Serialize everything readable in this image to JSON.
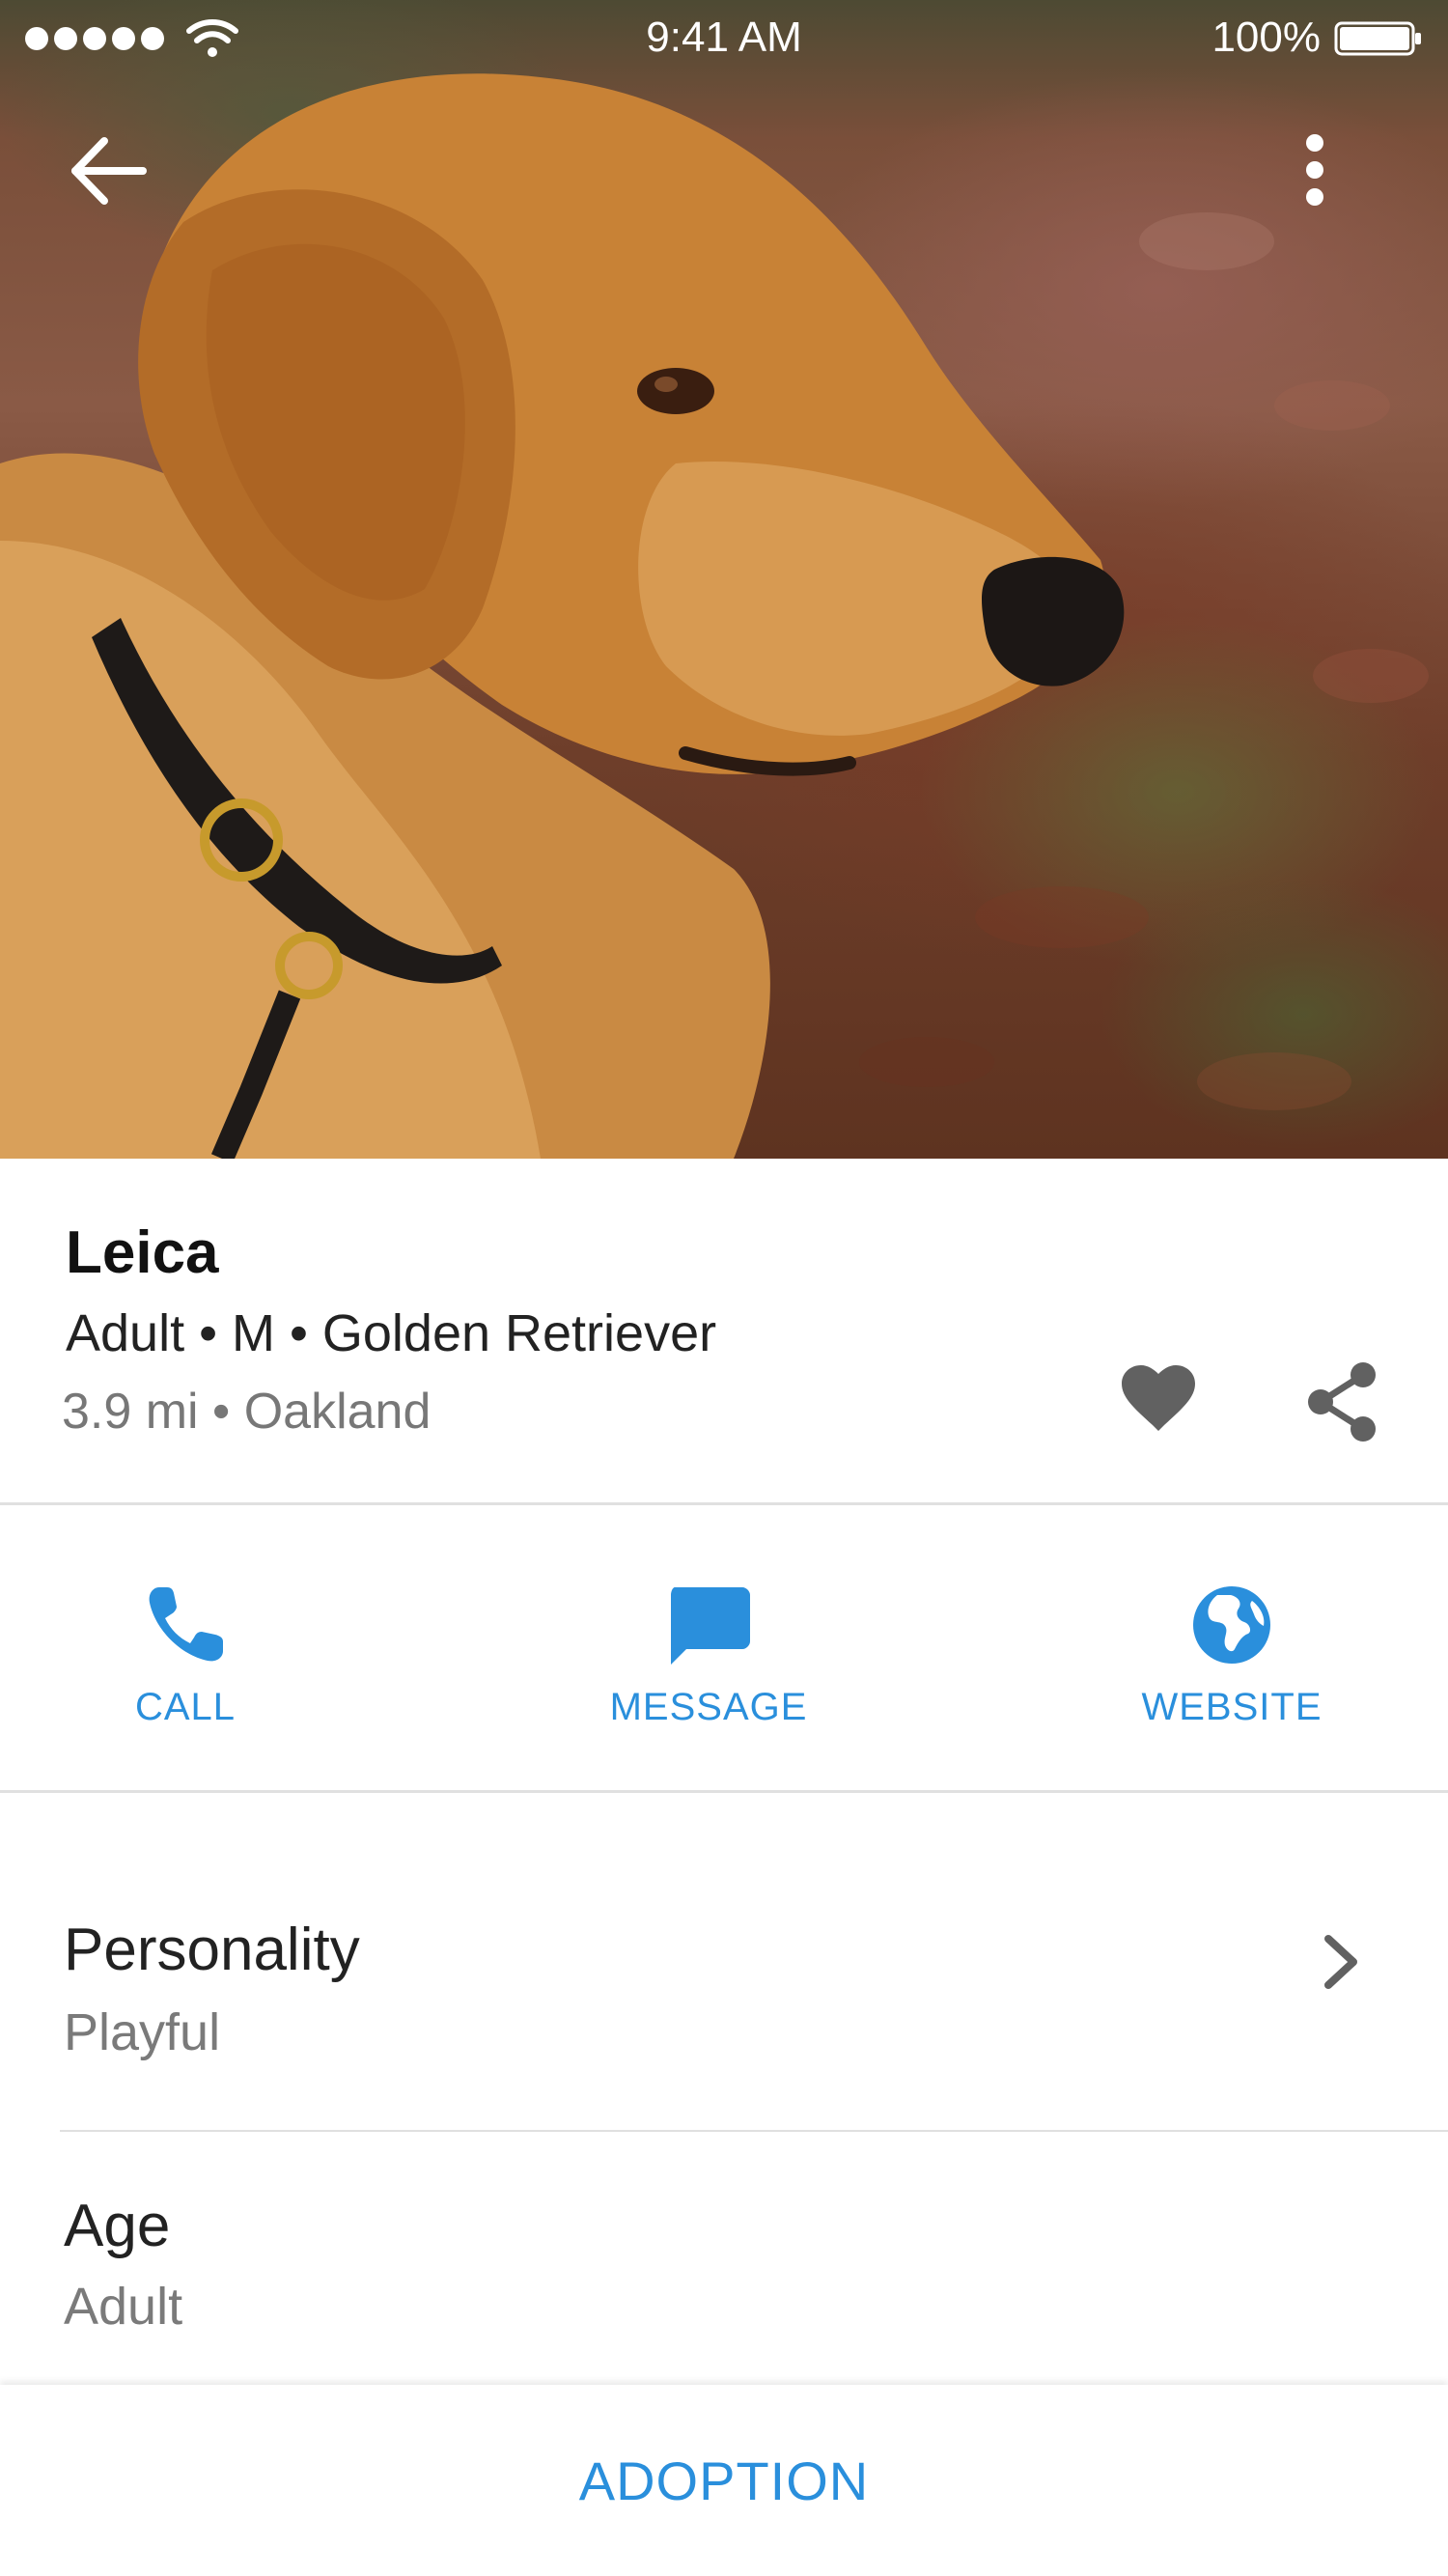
{
  "status_bar": {
    "time": "9:41 AM",
    "battery_percent": "100%",
    "signal_bars": 5
  },
  "header": {
    "back_icon": "arrow-back-icon",
    "menu_icon": "more-vert-icon"
  },
  "pet": {
    "name": "Leica",
    "summary": "Adult • M • Golden Retriever",
    "location": "3.9 mi • Oakland",
    "favorite_icon": "heart-icon",
    "share_icon": "share-icon"
  },
  "actions": [
    {
      "label": "CALL",
      "icon": "phone-icon"
    },
    {
      "label": "MESSAGE",
      "icon": "message-icon"
    },
    {
      "label": "WEBSITE",
      "icon": "globe-icon"
    }
  ],
  "details": [
    {
      "title": "Personality",
      "value": "Playful",
      "has_chevron": true
    },
    {
      "title": "Age",
      "value": "Adult",
      "has_chevron": false
    }
  ],
  "bottom": {
    "button_label": "ADOPTION"
  },
  "colors": {
    "accent": "#2A8FDC",
    "icon_gray": "#616161",
    "divider": "#E0E0E0"
  }
}
